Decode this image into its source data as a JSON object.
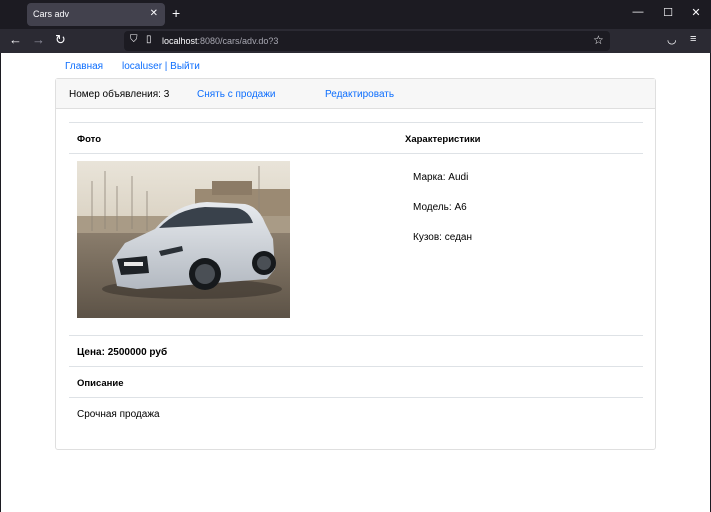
{
  "browser": {
    "tab_title": "Cars adv",
    "url_host": "localhost",
    "url_rest": ":8080/cars/adv.do?3"
  },
  "nav": {
    "home": "Главная",
    "user_logout": "localuser | Выйти"
  },
  "card": {
    "ad_number": "Номер объявления: 3",
    "remove_from_sale": "Снять с продажи",
    "edit": "Редактировать"
  },
  "table": {
    "photo_header": "Фото",
    "specs_header": "Характеристики",
    "brand": "Марка: Audi",
    "model": "Модель: А6",
    "body": "Кузов: седан",
    "price": "Цена: 2500000 руб",
    "description_header": "Описание",
    "description": "Срочная продажа"
  },
  "colors": {
    "link": "#0d6efd",
    "header_bg": "#f7f7f7",
    "chrome_dark": "#1c1b22",
    "toolbar": "#2b2a33"
  },
  "icons": [
    "close-icon",
    "plus-icon",
    "minimize-icon",
    "maximize-icon",
    "back-icon",
    "forward-icon",
    "reload-icon",
    "shield-icon",
    "page-icon",
    "bookmark-star-icon",
    "pocket-icon",
    "menu-icon"
  ]
}
